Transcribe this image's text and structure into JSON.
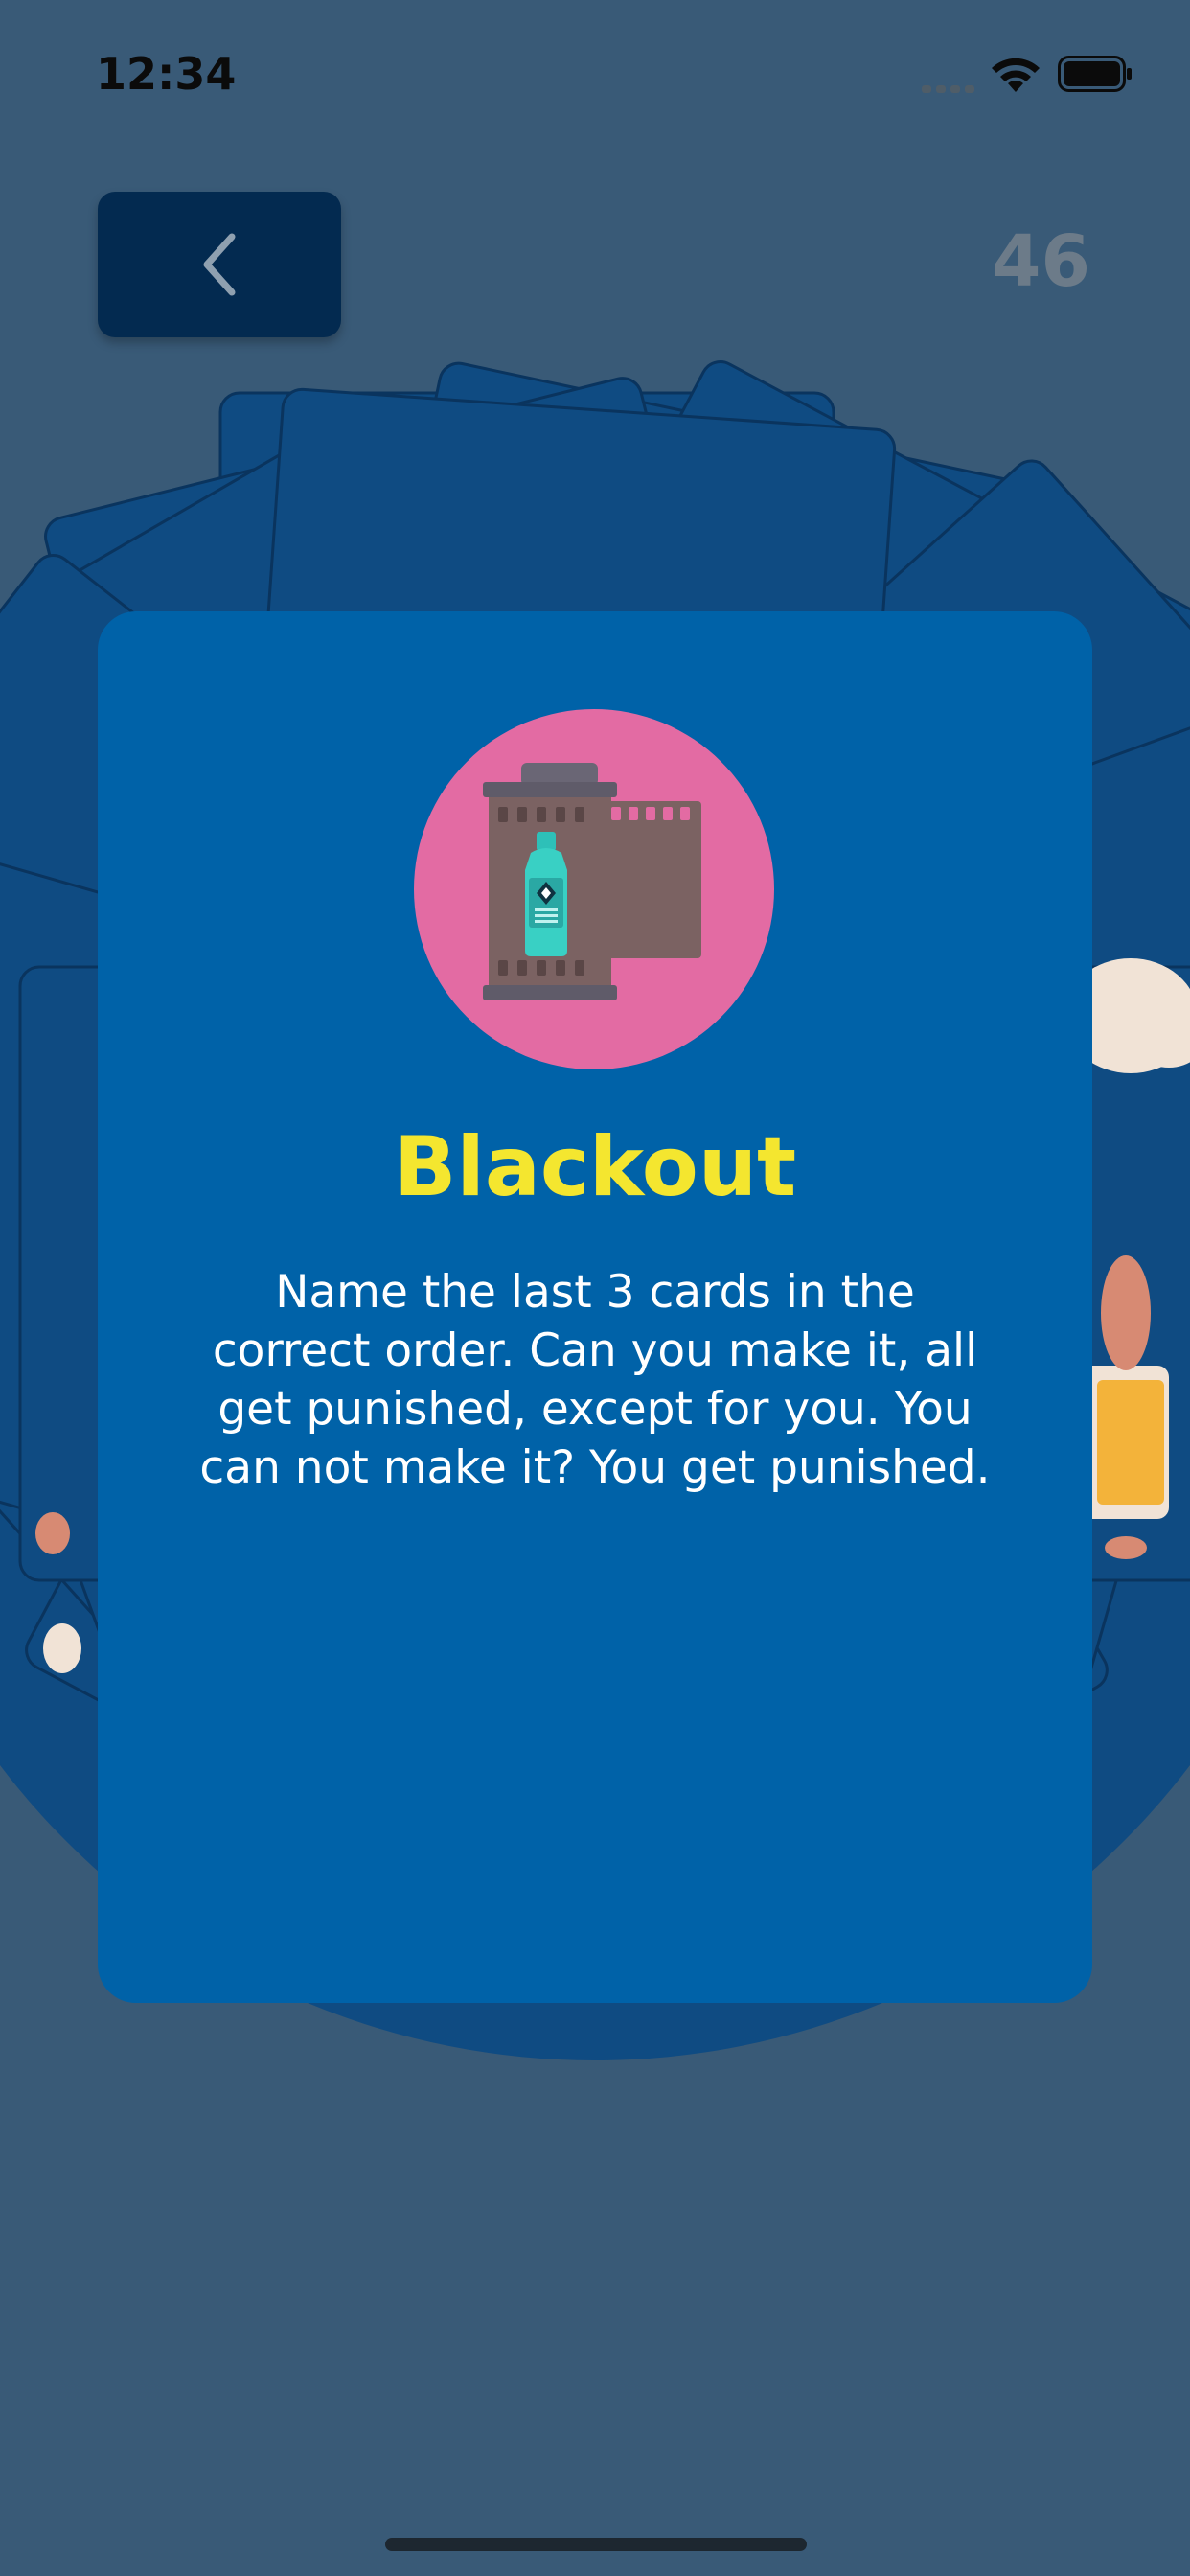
{
  "status_bar": {
    "time": "12:34"
  },
  "header": {
    "back_label": "",
    "counter": "46"
  },
  "card": {
    "title": "Blackout",
    "description": "Name the last 3 cards in the correct order. Can you make it, all get punished, except for you. You can not make it? You get punished.",
    "icon": "film-roll-bottle-icon"
  },
  "colors": {
    "background": "#395a77",
    "card": "#0062a8",
    "title": "#f4e62f",
    "back_button": "#032a50",
    "icon_circle": "#e36ba3"
  }
}
